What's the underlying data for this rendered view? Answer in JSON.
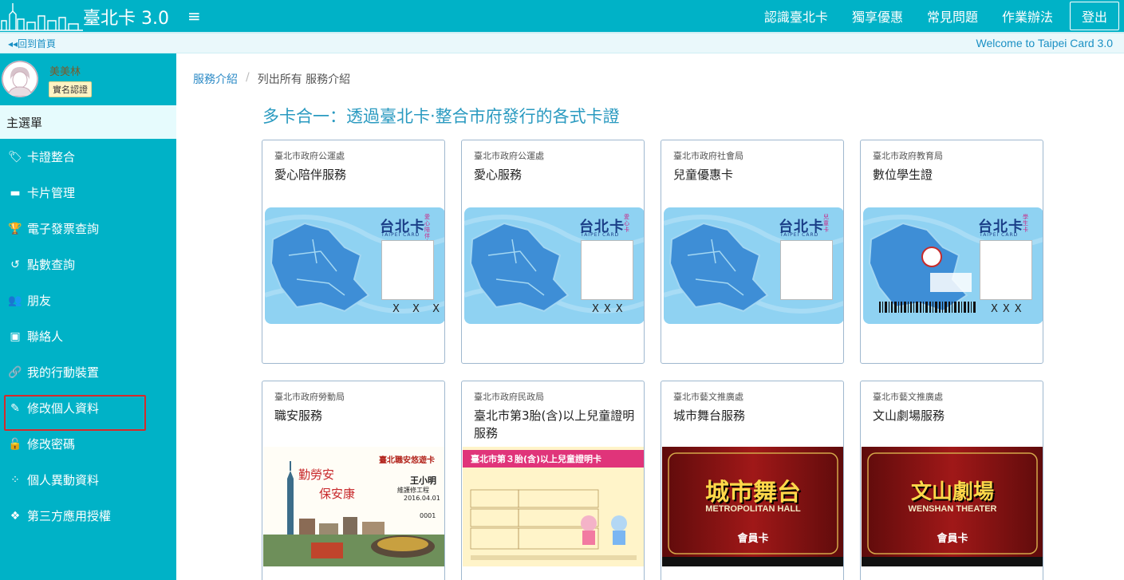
{
  "header": {
    "logo_text": "臺北卡 3.0",
    "nav": [
      "認識臺北卡",
      "獨享優惠",
      "常見問題",
      "作業辦法"
    ],
    "logout": "登出"
  },
  "subbar": {
    "back": "◂◂回到首頁",
    "welcome": "Welcome to Taipei Card 3.0"
  },
  "user": {
    "name": "美美林",
    "badge": "實名認證"
  },
  "sidebar": {
    "title": "主選單",
    "items": [
      {
        "label": "卡證整合",
        "icon": "tags-icon"
      },
      {
        "label": "卡片管理",
        "icon": "credit-card-icon"
      },
      {
        "label": "電子發票查詢",
        "icon": "trophy-icon"
      },
      {
        "label": "點數查詢",
        "icon": "history-icon"
      },
      {
        "label": "朋友",
        "icon": "users-icon"
      },
      {
        "label": "聯絡人",
        "icon": "contact-book-icon"
      },
      {
        "label": "我的行動裝置",
        "icon": "link-icon"
      },
      {
        "label": "修改個人資料",
        "icon": "edit-icon"
      },
      {
        "label": "修改密碼",
        "icon": "unlock-icon"
      },
      {
        "label": "個人異動資料",
        "icon": "spinner-icon"
      },
      {
        "label": "第三方應用授權",
        "icon": "cubes-icon"
      }
    ]
  },
  "breadcrumb": {
    "link": "服務介紹",
    "sep": "/",
    "current": "列出所有 服務介紹"
  },
  "page_title": "多卡合一：透過臺北卡‧整合市府發行的各式卡證",
  "cards": [
    {
      "dept": "臺北市政府公運處",
      "name": "愛心陪伴服務",
      "tag": "愛心陪伴卡",
      "xxx": "X X X"
    },
    {
      "dept": "臺北市政府公運處",
      "name": "愛心服務",
      "tag": "愛心卡",
      "xxx": "XXX"
    },
    {
      "dept": "臺北市政府社會局",
      "name": "兒童優惠卡",
      "tag": "兒童卡",
      "xxx": ""
    },
    {
      "dept": "臺北市政府教育局",
      "name": "數位學生證",
      "tag": "學生卡",
      "xxx": "XXX"
    },
    {
      "dept": "臺北市政府勞動局",
      "name": "職安服務",
      "poster_title": "臺北職安悠遊卡",
      "poster_lines": [
        "勤勞安",
        "保安康"
      ],
      "person": "王小明",
      "role": "維護修工程",
      "date": "2016.04.01",
      "serial": "0001"
    },
    {
      "dept": "臺北市政府民政局",
      "name": "臺北市第3胎(含)以上兒童證明服務",
      "poster_title": "臺北市第３胎(含)以上兒童證明卡"
    },
    {
      "dept": "臺北市藝文推廣處",
      "name": "城市舞台服務",
      "poster_title": "城市舞台",
      "poster_en": "METROPOLITAN HALL",
      "member": "會員卡"
    },
    {
      "dept": "臺北市藝文推廣處",
      "name": "文山劇場服務",
      "poster_title": "文山劇場",
      "poster_en": "WENSHAN THEATER",
      "member": "會員卡"
    }
  ],
  "card_logo": "台北卡",
  "card_logo_sub": "TAIPEI CARD",
  "colors": {
    "accent": "#00b2c7",
    "highlight": "#d62a2a",
    "title": "#2a9ac0"
  }
}
